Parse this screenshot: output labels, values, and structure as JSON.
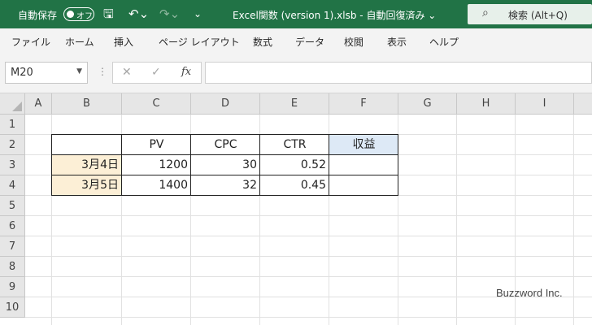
{
  "titlebar": {
    "autosave_label": "自動保存",
    "autosave_toggle": "オフ",
    "save_icon": "save-icon",
    "undo_icon": "undo-icon",
    "redo_icon": "redo-icon",
    "customize_icon": "customize-qat-icon",
    "document_title": "Excel関数 (version 1).xlsb  -  自動回復済み  ⌄",
    "search_label": "検索 (Alt+Q)",
    "accent_color": "#217346"
  },
  "ribbon": {
    "tabs": [
      "ファイル",
      "ホーム",
      "挿入",
      "ページ レイアウト",
      "数式",
      "データ",
      "校閲",
      "表示",
      "ヘルプ"
    ]
  },
  "formula_bar": {
    "name_box": "M20",
    "cancel_icon": "✕",
    "enter_icon": "✓",
    "fx_label": "fx",
    "formula": ""
  },
  "sheet": {
    "columns": [
      "A",
      "B",
      "C",
      "D",
      "E",
      "F",
      "G",
      "H",
      "I"
    ],
    "rows": [
      "1",
      "2",
      "3",
      "4",
      "5",
      "6",
      "7",
      "8",
      "9",
      "10"
    ],
    "headers": {
      "pv": "PV",
      "cpc": "CPC",
      "ctr": "CTR",
      "revenue": "収益"
    },
    "data_rows": [
      {
        "date": "3月4日",
        "pv": "1200",
        "cpc": "30",
        "ctr": "0.52",
        "revenue": ""
      },
      {
        "date": "3月5日",
        "pv": "1400",
        "cpc": "32",
        "ctr": "0.45",
        "revenue": ""
      }
    ]
  },
  "watermark": "Buzzword Inc."
}
